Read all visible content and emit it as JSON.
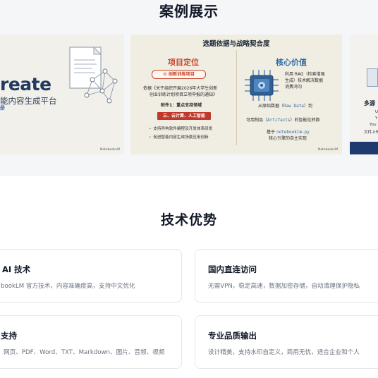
{
  "cases": {
    "title": "案例展示",
    "slide_left": {
      "heading": "reate",
      "subtitle": "能内容生成平台",
      "tag": "册",
      "footer": "NotebookLM"
    },
    "slide_mid": {
      "title": "选题依据与战略契合度",
      "left_title": "项目定位",
      "badge": "创新训练项目",
      "basis_line1": "依据《关于组织开展2026年大学生创新",
      "basis_line2": "创业训练计划项目立项申报的通知》",
      "attachment": "附件1：重点支持领域",
      "focus_band": "三、云计算、人工智能",
      "bullet1": "支持异构软件编程及开发体系研发",
      "bullet2": "促进智能内容生成场景应用创新",
      "right_title": "核心价值",
      "rag_line1": "利用 RAG（检索增强",
      "rag_line2": "生成）技术解决数据",
      "rag_line3": "消费鸿沟",
      "raw_prefix": "从原始数据（",
      "raw_code": "Raw Data",
      "raw_suffix": "）到",
      "art_prefix": "可用制品（",
      "art_code": "Artifacts",
      "art_suffix": "）的智能化转换",
      "based_prefix": "基于",
      "based_code": "notebooklm-py",
      "based_suffix": "核心引擎的自主实现",
      "footer": "NotebookLM"
    },
    "slide_right": {
      "title": "多源",
      "line1": "U",
      "line2": "Y",
      "line3": "You",
      "line4": "文件上传"
    }
  },
  "advantages": {
    "title": "技术优势",
    "cards": [
      {
        "title": "AI 技术",
        "desc": "bookLM 官方技术，内容准确度高，支持中文优化"
      },
      {
        "title": "国内直连访问",
        "desc": "无需VPN，稳定高速，数据加密存储，自动清理保护隐私"
      },
      {
        "title": "支持",
        "desc": "网页、PDF、Word、TXT、Markdown、图片、音频、视频"
      },
      {
        "title": "专业品质输出",
        "desc": "设计精美，支持水印自定义，商用无忧，适合企业和个人"
      }
    ]
  },
  "colors": {
    "accent_red": "#c0392b",
    "accent_blue": "#2f6aa3",
    "navy": "#223a5e",
    "section_bg": "#f5f6f8"
  }
}
